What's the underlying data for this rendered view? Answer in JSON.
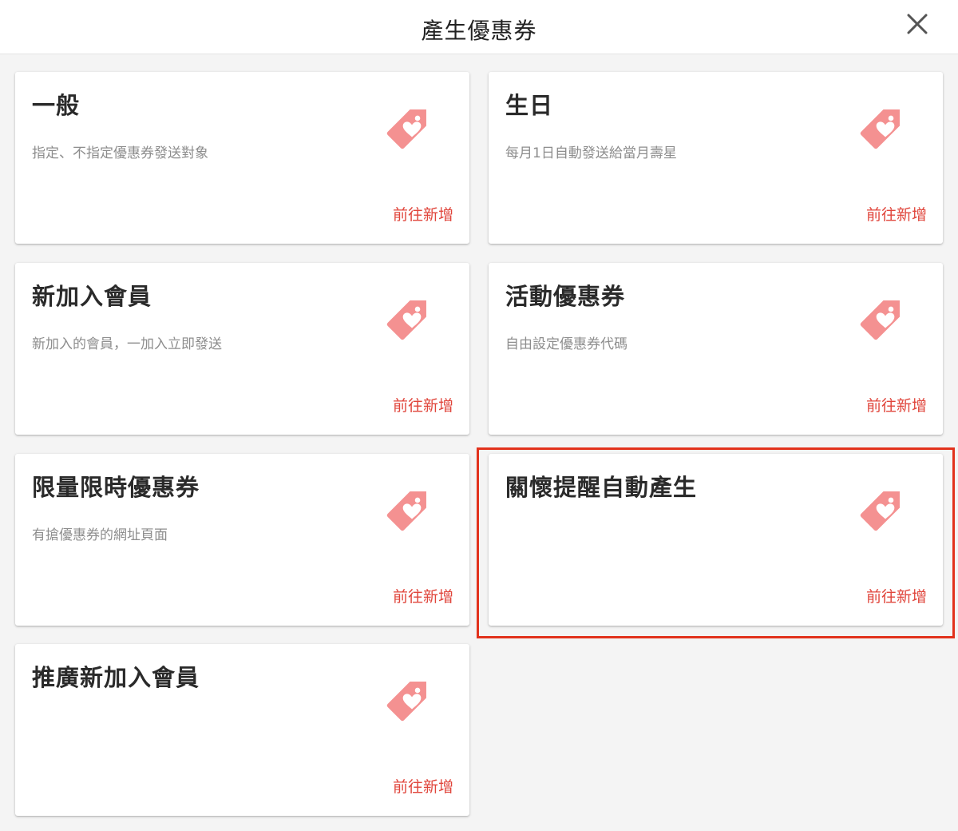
{
  "dialog": {
    "title": "產生優惠券",
    "close_icon": "close-icon"
  },
  "colors": {
    "accent": "#e0463c",
    "tag_icon": "#f49191",
    "highlight": "#e2321c"
  },
  "cards": [
    {
      "title": "一般",
      "description": "指定、不指定優惠券發送對象",
      "action": "前往新增",
      "icon": "tag-heart-icon"
    },
    {
      "title": "生日",
      "description": "每月1日自動發送給當月壽星",
      "action": "前往新增",
      "icon": "tag-heart-icon"
    },
    {
      "title": "新加入會員",
      "description": "新加入的會員，一加入立即發送",
      "action": "前往新增",
      "icon": "tag-heart-icon"
    },
    {
      "title": "活動優惠券",
      "description": "自由設定優惠券代碼",
      "action": "前往新增",
      "icon": "tag-heart-icon"
    },
    {
      "title": "限量限時優惠券",
      "description": "有搶優惠券的網址頁面",
      "action": "前往新增",
      "icon": "tag-heart-icon"
    },
    {
      "title": "關懷提醒自動產生",
      "description": "",
      "action": "前往新增",
      "icon": "tag-heart-icon",
      "highlighted": true
    },
    {
      "title": "推廣新加入會員",
      "description": "",
      "action": "前往新增",
      "icon": "tag-heart-icon"
    }
  ]
}
